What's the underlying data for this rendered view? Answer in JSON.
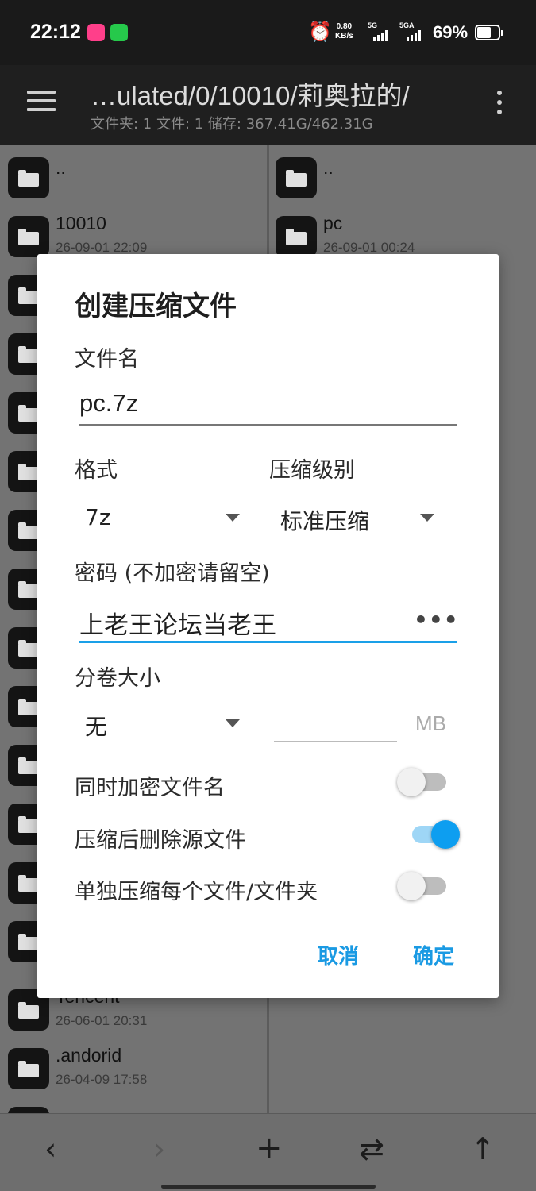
{
  "status_bar": {
    "time": "22:12",
    "net_speed_value": "0.80",
    "net_speed_unit": "KB/s",
    "net1": "5G",
    "net2": "5GA",
    "battery": "69%"
  },
  "app_bar": {
    "path": "…ulated/0/10010/莉奥拉的/",
    "summary": "文件夹: 1  文件: 1  储存: 367.41G/462.31G"
  },
  "left_pane": {
    "items": [
      {
        "name": "..",
        "date": ""
      },
      {
        "name": "10010",
        "date": "26-09-01 22:09"
      },
      {
        "name": "Tencent",
        "date": "26-06-01 20:31"
      },
      {
        "name": ".andorid",
        "date": "26-04-09 17:58"
      }
    ]
  },
  "right_pane": {
    "items": [
      {
        "name": "..",
        "date": ""
      },
      {
        "name": "pc",
        "date": "26-09-01 00:24"
      }
    ]
  },
  "dialog": {
    "title": "创建压缩文件",
    "filename_label": "文件名",
    "filename_value": "pc.7z",
    "format_label": "格式",
    "format_value": "7z",
    "level_label": "压缩级别",
    "level_value": "标准压缩",
    "password_label": "密码 (不加密请留空)",
    "password_value": "上老王论坛当老王",
    "password_toggle": "•••",
    "split_label": "分卷大小",
    "split_value": "无",
    "split_unit": "MB",
    "encrypt_names_label": "同时加密文件名",
    "encrypt_names_on": false,
    "delete_source_label": "压缩后删除源文件",
    "delete_source_on": true,
    "separate_label": "单独压缩每个文件/文件夹",
    "separate_on": false,
    "cancel_label": "取消",
    "ok_label": "确定"
  },
  "bottom_nav": {
    "back": "‹",
    "forward": "›",
    "add": "+",
    "swap": "⇄",
    "up": "↑"
  },
  "colors": {
    "accent": "#1a9ae3",
    "toggle_on": "#0d9ef0",
    "appbar": "#1f1f1f",
    "scrim_pane": "#737373"
  }
}
